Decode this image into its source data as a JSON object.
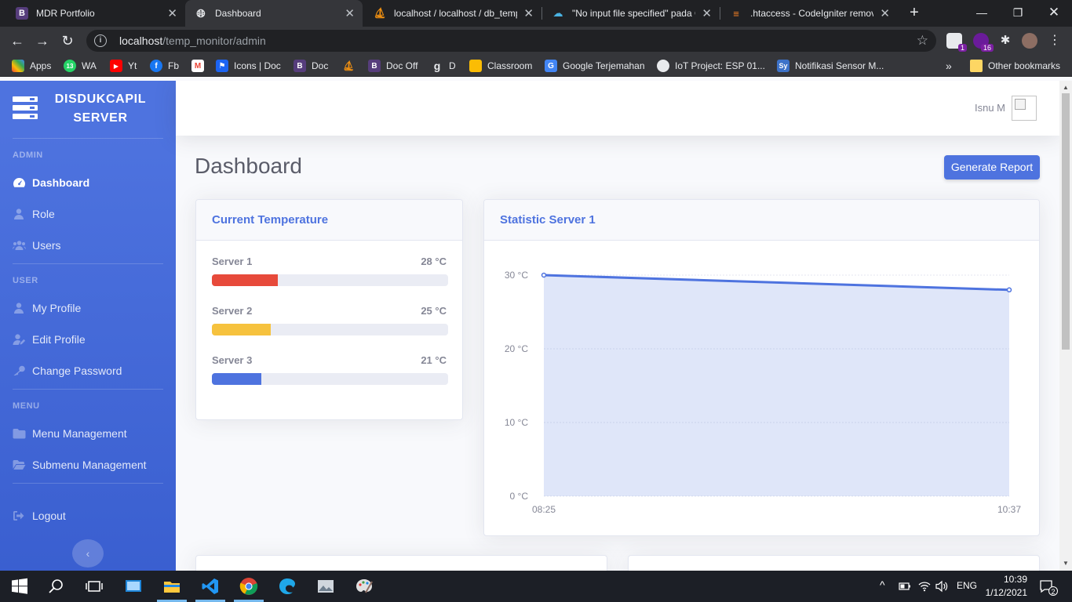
{
  "browser": {
    "tabs": [
      {
        "label": "MDR Portfolio",
        "favicon": "bootstrap-icon",
        "active": false
      },
      {
        "label": "Dashboard",
        "favicon": "globe-icon",
        "active": true
      },
      {
        "label": "localhost / localhost / db_temp",
        "favicon": "phpmyadmin-icon",
        "active": false
      },
      {
        "label": "\"No input file specified\" pada C",
        "favicon": "cloud-icon",
        "active": false
      },
      {
        "label": ".htaccess - CodeIgniter removi",
        "favicon": "stackoverflow-icon",
        "active": false
      }
    ],
    "url_host": "localhost",
    "url_path": "/temp_monitor/admin",
    "bookmarks": [
      {
        "label": "Apps",
        "icon": "apps-grid-icon"
      },
      {
        "label": "WA",
        "icon": "whatsapp-icon",
        "badge": "13"
      },
      {
        "label": "Yt",
        "icon": "youtube-icon"
      },
      {
        "label": "Fb",
        "icon": "facebook-icon"
      },
      {
        "label": "",
        "icon": "gmail-icon"
      },
      {
        "label": "Icons | Doc",
        "icon": "flag-icon"
      },
      {
        "label": "Doc",
        "icon": "bootstrap-icon"
      },
      {
        "label": "",
        "icon": "phpmyadmin-icon"
      },
      {
        "label": "Doc Off",
        "icon": "bootstrap-icon"
      },
      {
        "label": "D",
        "icon": "g-icon"
      },
      {
        "label": "Classroom",
        "icon": "classroom-icon"
      },
      {
        "label": "Google Terjemahan",
        "icon": "translate-icon"
      },
      {
        "label": "IoT Project: ESP 01...",
        "icon": "iot-icon"
      },
      {
        "label": "Notifikasi Sensor M...",
        "icon": "sy-icon"
      }
    ],
    "bookmarks_overflow": "»",
    "other_bookmarks": "Other bookmarks",
    "ext_badge_1": "1",
    "ext_badge_2": "16"
  },
  "sidebar": {
    "brand": "DISDUKCAPIL SERVER",
    "sections": [
      {
        "heading": "ADMIN",
        "items": [
          {
            "label": "Dashboard",
            "icon": "tachometer-icon",
            "active": true
          },
          {
            "label": "Role",
            "icon": "user-tie-icon"
          },
          {
            "label": "Users",
            "icon": "users-icon"
          }
        ]
      },
      {
        "heading": "USER",
        "items": [
          {
            "label": "My Profile",
            "icon": "user-icon"
          },
          {
            "label": "Edit Profile",
            "icon": "user-edit-icon"
          },
          {
            "label": "Change Password",
            "icon": "key-icon"
          }
        ]
      },
      {
        "heading": "MENU",
        "items": [
          {
            "label": "Menu Management",
            "icon": "folder-icon"
          },
          {
            "label": "Submenu Management",
            "icon": "folder-open-icon"
          }
        ]
      }
    ],
    "logout": "Logout",
    "toggle": "‹"
  },
  "topbar": {
    "user_name": "Isnu M"
  },
  "main": {
    "title": "Dashboard",
    "generate_report": "Generate Report",
    "current_temp": {
      "title": "Current Temperature",
      "servers": [
        {
          "name": "Server 1",
          "value": "28 °C",
          "percent": 28,
          "color": "#e74a3b"
        },
        {
          "name": "Server 2",
          "value": "25 °C",
          "percent": 25,
          "color": "#f6c23e"
        },
        {
          "name": "Server 3",
          "value": "21 °C",
          "percent": 21,
          "color": "#4e73df"
        }
      ]
    },
    "statistic": {
      "title": "Statistic Server 1"
    }
  },
  "chart_data": {
    "type": "area",
    "title": "Statistic Server 1",
    "x": [
      "08:25",
      "10:37"
    ],
    "series": [
      {
        "values": [
          30,
          28
        ]
      }
    ],
    "ylim": [
      0,
      30
    ],
    "yticks": [
      "0 °C",
      "10 °C",
      "20 °C",
      "30 °C"
    ],
    "ytick_values": [
      0,
      10,
      20,
      30
    ],
    "grid": true,
    "line_color": "#4e73df",
    "fill_color": "rgba(78,115,223,0.18)"
  },
  "taskbar": {
    "lang": "ENG",
    "time": "10:39",
    "date": "1/12/2021",
    "notifications": "2"
  }
}
